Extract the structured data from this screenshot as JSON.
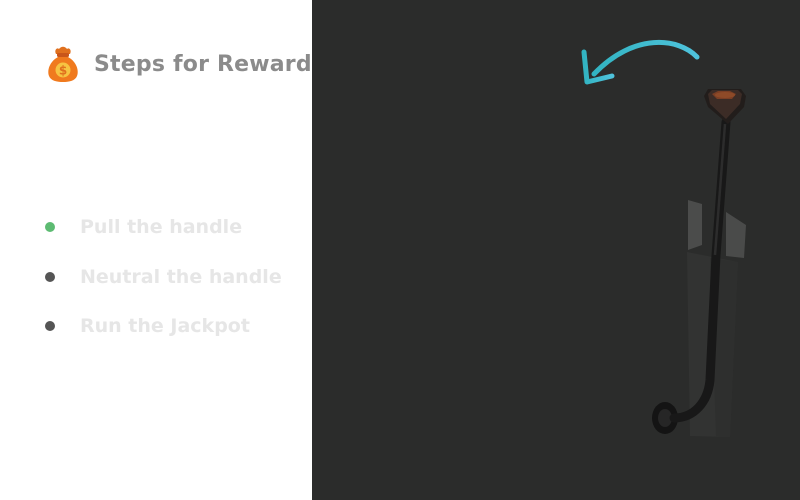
{
  "panel": {
    "title": "Steps for Reward",
    "title_icon": "money-bag-icon"
  },
  "steps": [
    {
      "label": "Pull the handle",
      "status": "active",
      "dot_color": "#5dbb72"
    },
    {
      "label": "Neutral the handle",
      "status": "pending",
      "dot_color": "#555555"
    },
    {
      "label": "Run the Jackpot",
      "status": "pending",
      "dot_color": "#555555"
    }
  ],
  "scene": {
    "background": "#2b2c2b",
    "arrow_icon": "curved-arrow-left-icon",
    "arrow_color": "#3fb8c9",
    "lever_icon": "slot-machine-lever-icon"
  }
}
